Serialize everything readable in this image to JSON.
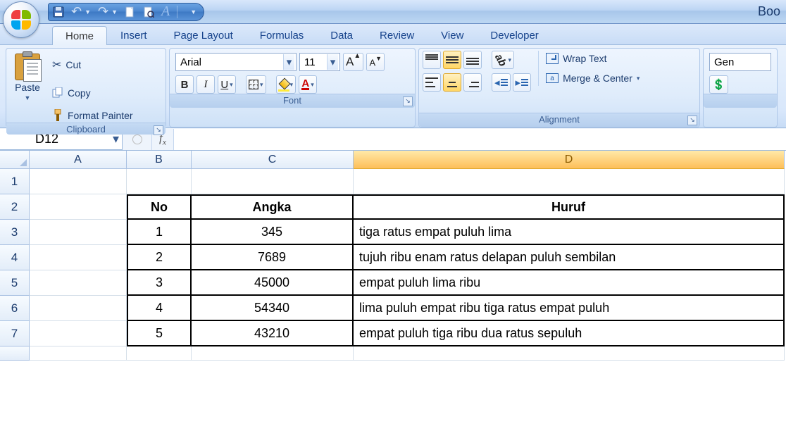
{
  "app": {
    "title_fragment": "Boo"
  },
  "qat": {
    "items": [
      "save",
      "undo",
      "redo",
      "new",
      "print-preview",
      "spellcheck"
    ]
  },
  "tabs": [
    "Home",
    "Insert",
    "Page Layout",
    "Formulas",
    "Data",
    "Review",
    "View",
    "Developer"
  ],
  "active_tab": 0,
  "ribbon": {
    "clipboard": {
      "label": "Clipboard",
      "paste": "Paste",
      "cut": "Cut",
      "copy": "Copy",
      "format_painter": "Format Painter"
    },
    "font": {
      "label": "Font",
      "name": "Arial",
      "size": "11"
    },
    "alignment": {
      "label": "Alignment",
      "wrap": "Wrap Text",
      "merge": "Merge & Center"
    },
    "number": {
      "format": "Gen"
    }
  },
  "name_box": "D12",
  "formula": "",
  "columns": [
    "A",
    "B",
    "C",
    "D"
  ],
  "selected_col": "D",
  "row_numbers": [
    "1",
    "2",
    "3",
    "4",
    "5",
    "6",
    "7"
  ],
  "table": {
    "headers": {
      "no": "No",
      "angka": "Angka",
      "huruf": "Huruf"
    },
    "rows": [
      {
        "no": "1",
        "angka": "345",
        "huruf": "tiga ratus empat puluh lima"
      },
      {
        "no": "2",
        "angka": "7689",
        "huruf": "tujuh ribu enam ratus delapan puluh sembilan"
      },
      {
        "no": "3",
        "angka": "45000",
        "huruf": "empat puluh lima ribu"
      },
      {
        "no": "4",
        "angka": "54340",
        "huruf": "lima puluh empat ribu tiga ratus empat puluh"
      },
      {
        "no": "5",
        "angka": "43210",
        "huruf": "empat puluh tiga ribu dua ratus sepuluh"
      }
    ]
  }
}
